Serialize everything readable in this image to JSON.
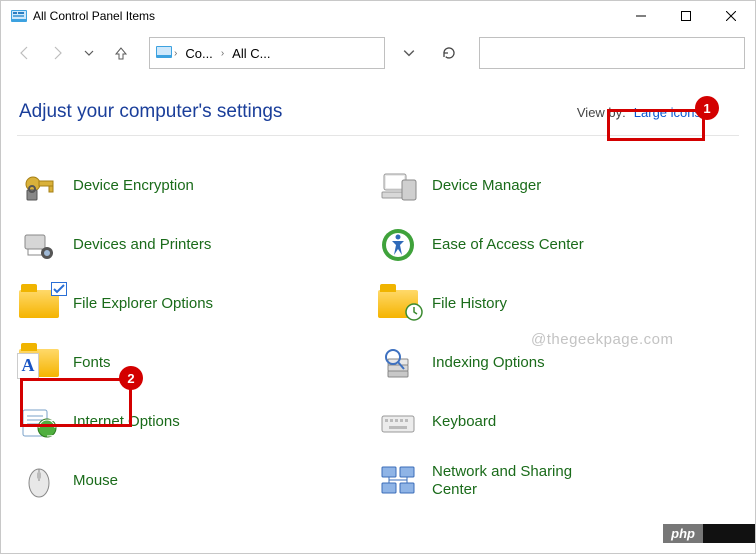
{
  "window": {
    "title": "All Control Panel Items"
  },
  "breadcrumb": {
    "seg1": "Co...",
    "seg2": "All C..."
  },
  "heading": "Adjust your computer's settings",
  "viewby": {
    "label": "View by:",
    "value": "Large icons"
  },
  "items": {
    "left": [
      {
        "name": "device-encryption",
        "label": "Device Encryption"
      },
      {
        "name": "devices-and-printers",
        "label": "Devices and Printers"
      },
      {
        "name": "file-explorer-options",
        "label": "File Explorer Options"
      },
      {
        "name": "fonts",
        "label": "Fonts"
      },
      {
        "name": "internet-options",
        "label": "Internet Options"
      },
      {
        "name": "mouse",
        "label": "Mouse"
      }
    ],
    "right": [
      {
        "name": "device-manager",
        "label": "Device Manager"
      },
      {
        "name": "ease-of-access-center",
        "label": "Ease of Access Center"
      },
      {
        "name": "file-history",
        "label": "File History"
      },
      {
        "name": "indexing-options",
        "label": "Indexing Options"
      },
      {
        "name": "keyboard",
        "label": "Keyboard"
      },
      {
        "name": "network-and-sharing-center",
        "label": "Network and Sharing Center"
      }
    ]
  },
  "watermark": "@thegeekpage.com",
  "callouts": {
    "one": "1",
    "two": "2"
  },
  "phptag": "php"
}
